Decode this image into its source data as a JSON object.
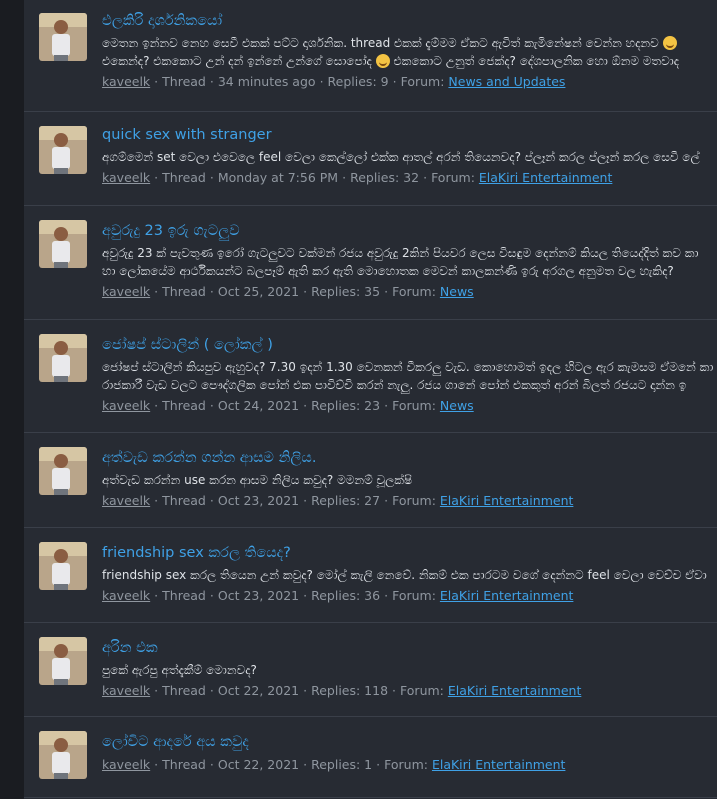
{
  "results": [
    {
      "title": "එලකිරි දාර්ශනිකයෝ",
      "snippet_1": "මෙතන ඉන්නව නෙහ සෙවී එකක් පට්ට දාර්ශනික. thread එකක් දැම්මම ඒකට ඇවිත් කැමිනේෂන් වෙන්න හදනව",
      "snippet_2": "එකෙන්ද? එකකොට උන් දන් ඉන්නේ උන්ගේ සොපෝද",
      "snippet_3": "එකකොට උනුත් ජෙක්ද? දේශපාලනික හො ඕනම මතවාද",
      "smileys_in_snippet": 2,
      "user": "kaveelk",
      "type": "Thread",
      "time": "34 minutes ago",
      "replies": "Replies: 9",
      "forum_label": "Forum:",
      "forum": "News and Updates"
    },
    {
      "title": "quick sex with stranger",
      "snippet_1": "අගම්මෙන් set වෙලා එවෙලෙ feel වෙලා කෙල්ලෝ එක්ක ආතල් අරන් තියෙනවද? ප්ලෑන් කරල ප්ලෑන් කරල සෙවී ලේ",
      "user": "kaveelk",
      "type": "Thread",
      "time": "Monday at 7:56 PM",
      "replies": "Replies: 32",
      "forum_label": "Forum:",
      "forum": "ElaKiri Entertainment"
    },
    {
      "title": "අවුරුදු 23 ඉරු ගැටලුව",
      "snippet_1": "අවුරුදු 23 ක් පැවතුණ ඉරෝ ගැටලුවට වක්මන් රජය අවුරුදු 2කින් පියවර ලෙස විසඳුම දෙන්නම් කියල තියෙද්දිත් කව කා",
      "snippet_2": "හා ලෝකයේම ආර්ථිකයන්ට බලපෑම් ඇති කර ඇති මොහොතක මෙවන් කාලකන්ණි ඉරු අරගල අනුමත වල හැකිද?",
      "user": "kaveelk",
      "type": "Thread",
      "time": "Oct 25, 2021",
      "replies": "Replies: 35",
      "forum_label": "Forum:",
      "forum": "News"
    },
    {
      "title": "ජෝෂප් ස්ටාලින් ( ලෝකල් )",
      "snippet_1": "ජෝෂප් ස්ටාලින් කියපුව ඇහුවද? 7.30 ඉදන් 1.30 වෙනකන් වීකරලු වැඩ. කොහොමත් ඉදල හිටල ඇර කැමසම ඒමනේ කා",
      "snippet_2": "රාජකාරී වැඩ වලට පෞද්ගලික පෝන් එක පාවිච්චි කරන් නැලු. රජය ගානේ පෝන් එකකුත් අරන් බිලත් රජයට දාන්න ඉ",
      "user": "kaveelk",
      "type": "Thread",
      "time": "Oct 24, 2021",
      "replies": "Replies: 23",
      "forum_label": "Forum:",
      "forum": "News"
    },
    {
      "title": "අත්වැඩ කරන්න ගන්න ආසම නිලිය.",
      "snippet_1": "අත්වැඩ කරන්න use කරන ආසම නිලිය කවුද? මමනම් චූලක්ෂි",
      "user": "kaveelk",
      "type": "Thread",
      "time": "Oct 23, 2021",
      "replies": "Replies: 27",
      "forum_label": "Forum:",
      "forum": "ElaKiri Entertainment"
    },
    {
      "title": "friendship sex කරල තියෙද?",
      "snippet_1": "friendship sex කරල තියෙන උන් කවුද? මෝල් කැලි නෙවේ. නිකම් එක පාරටම වගේ දෙන්නට feel වෙලා වෙච්ච ඒවා",
      "user": "kaveelk",
      "type": "Thread",
      "time": "Oct 23, 2021",
      "replies": "Replies: 36",
      "forum_label": "Forum:",
      "forum": "ElaKiri Entertainment"
    },
    {
      "title": "අරින එක",
      "snippet_1": "පුකේ ඇරපු අත්දැකීම් මොනවද?",
      "user": "kaveelk",
      "type": "Thread",
      "time": "Oct 22, 2021",
      "replies": "Replies: 118",
      "forum_label": "Forum:",
      "forum": "ElaKiri Entertainment"
    },
    {
      "title": "ලෝචිට ආදරේ අය කවුද",
      "user": "kaveelk",
      "type": "Thread",
      "time": "Oct 22, 2021",
      "replies": "Replies: 1",
      "forum_label": "Forum:",
      "forum": "ElaKiri Entertainment"
    }
  ],
  "separator": "·",
  "icons": {
    "avatar": "user-avatar-photo",
    "smiley": "grinning-smiley-icon"
  },
  "colors": {
    "link": "#3fa1e6",
    "panel": "#272b33",
    "text": "#dfe3e8",
    "muted": "#8f969f"
  }
}
